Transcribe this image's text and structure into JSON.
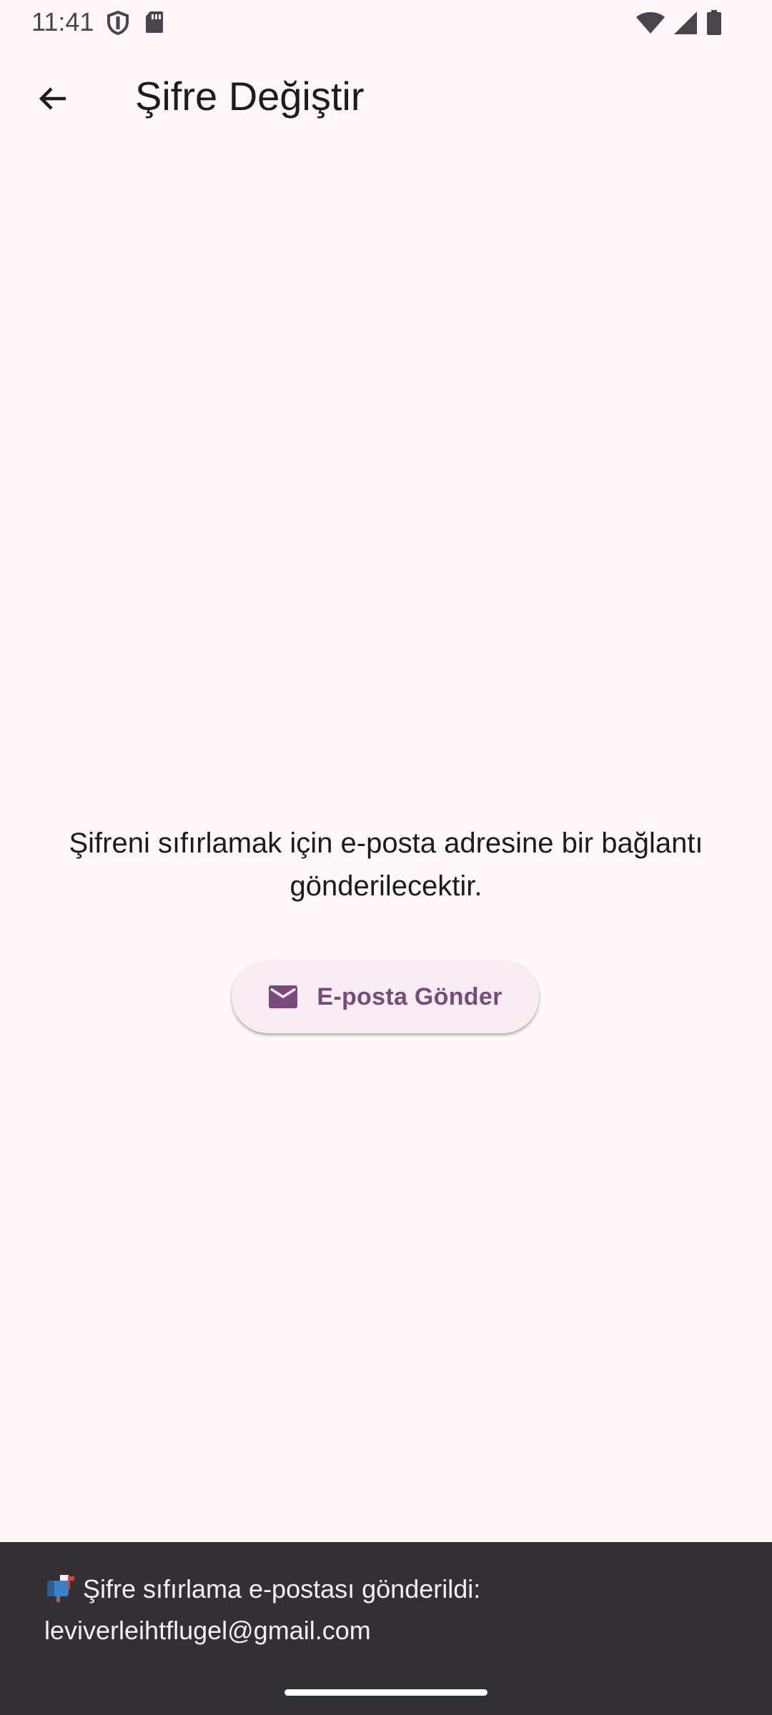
{
  "status_bar": {
    "time": "11:41",
    "icons": [
      "shield-icon",
      "sd-card-icon",
      "wifi-icon",
      "cellular-signal-icon",
      "battery-icon"
    ]
  },
  "app_bar": {
    "back_icon": "arrow-back-icon",
    "title": "Şifre Değiştir"
  },
  "main": {
    "info_text": "Şifreni sıfırlamak için e-posta adresine bir bağlantı gönderilecektir.",
    "send_button": {
      "icon": "mail-icon",
      "label": "E-posta Gönder"
    }
  },
  "snackbar": {
    "emoji": "📬",
    "message_line1": "Şifre sıfırlama e-postası gönderildi:",
    "message_line2": "leviverleihtflugel@gmail.com"
  },
  "colors": {
    "background": "#FFF7F9",
    "button_background": "#F7EDF2",
    "accent": "#7A4A7F",
    "snackbar_background": "#322F35",
    "snackbar_text": "#F5EFF7"
  }
}
